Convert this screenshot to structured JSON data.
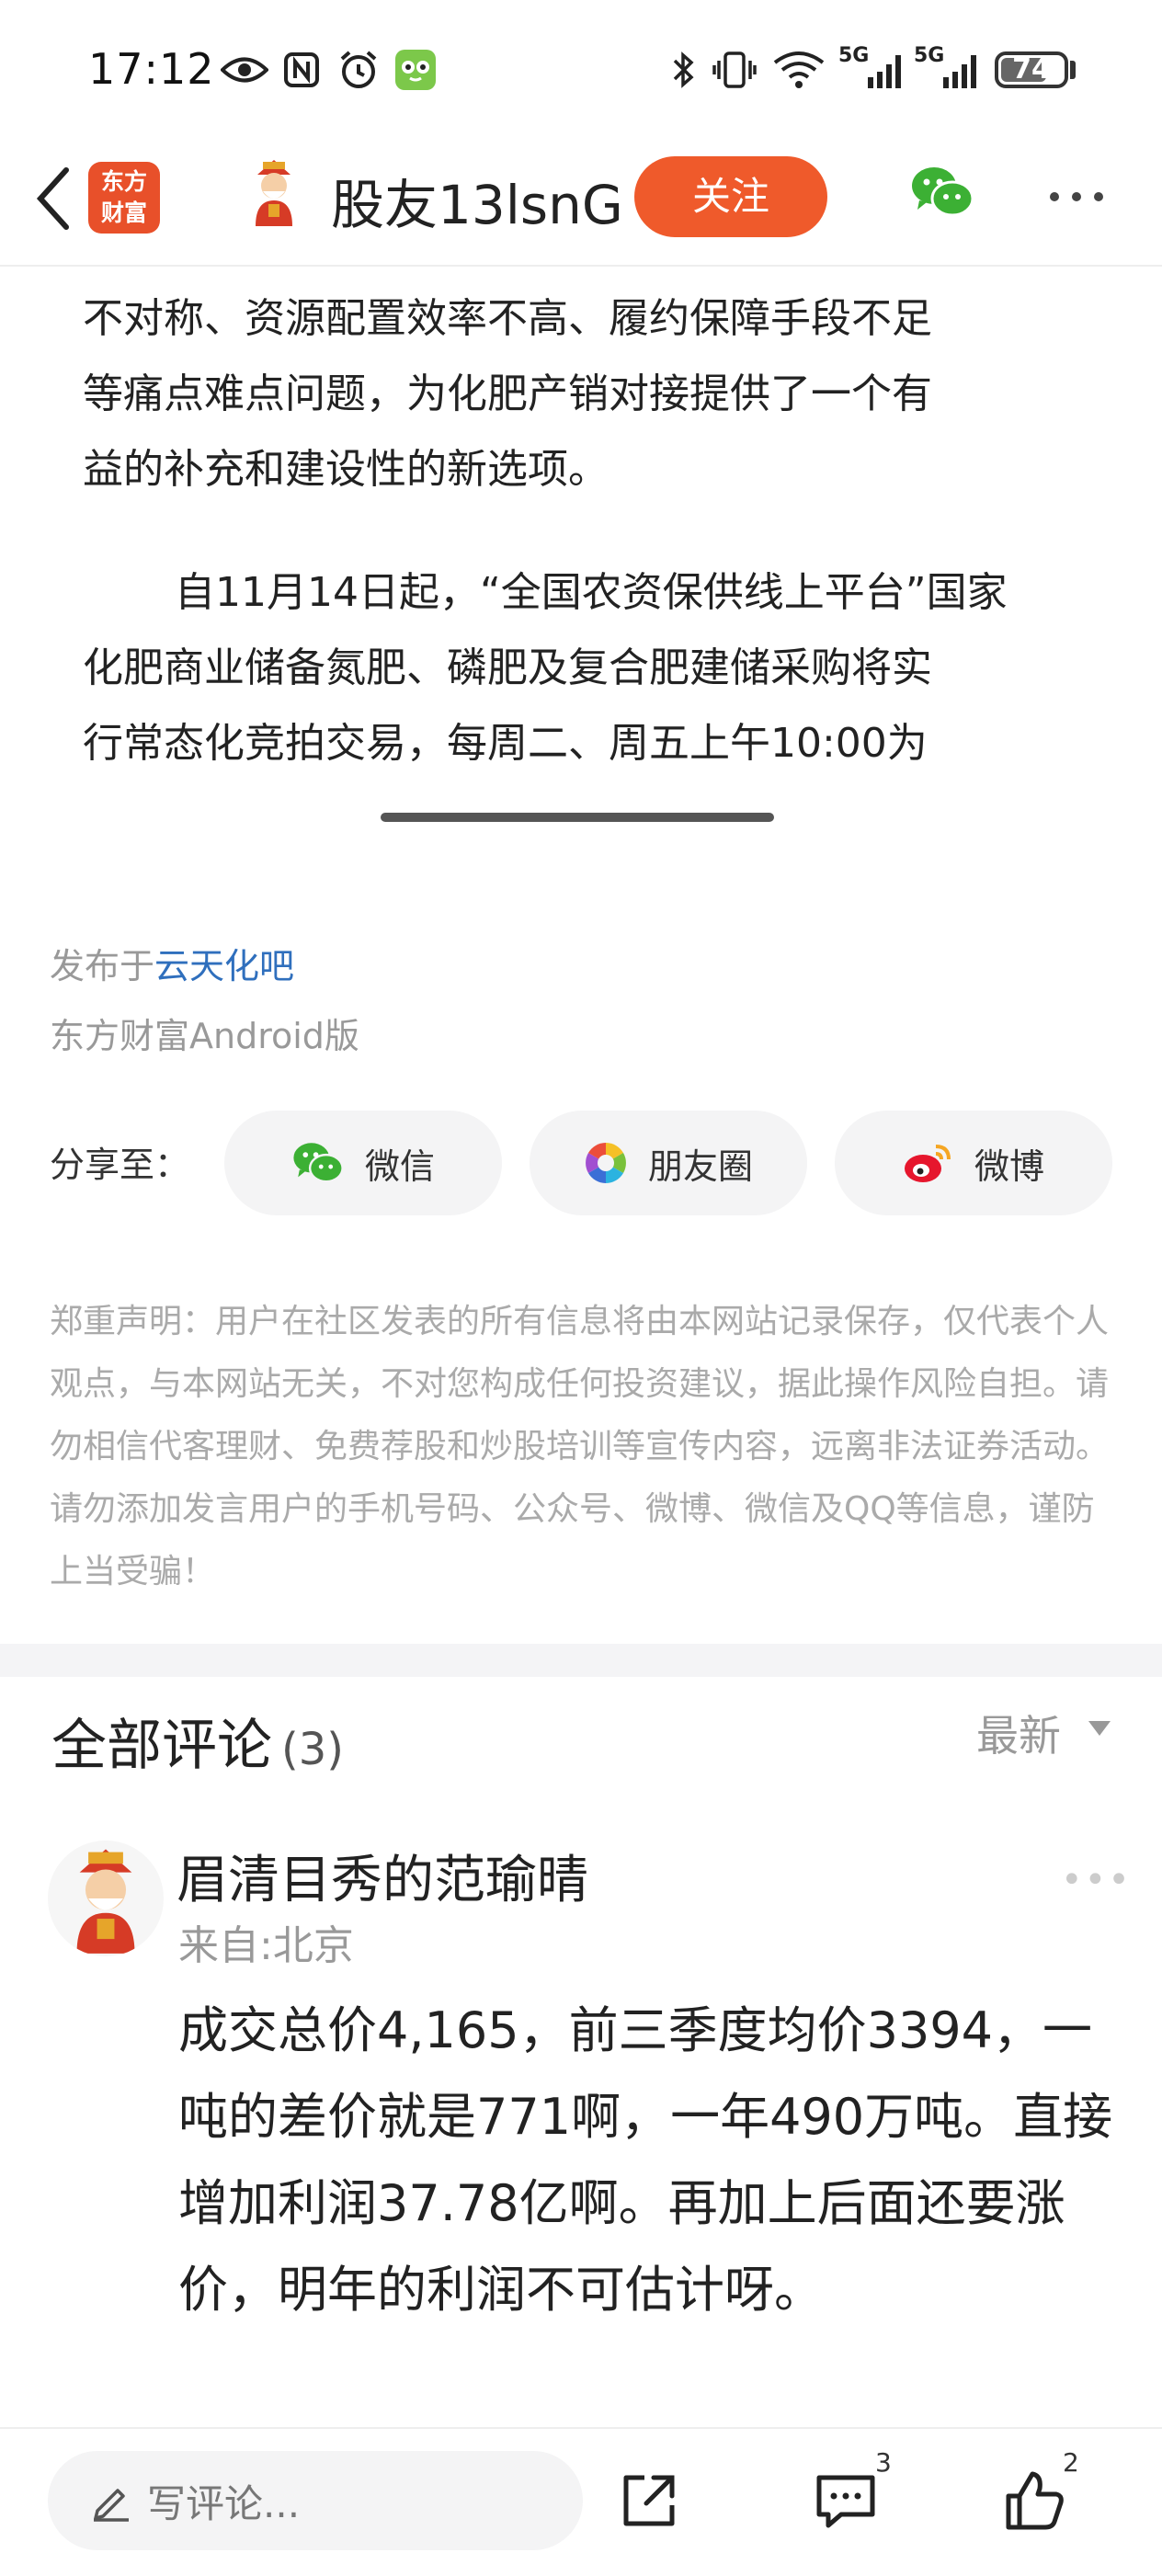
{
  "status_bar": {
    "time": "17:12",
    "network_1": "5G",
    "network_2": "5G",
    "battery": "74",
    "battery_level": 0.74
  },
  "header": {
    "logo_text": "东方\n财富",
    "username": "股友13lsnG",
    "follow_label": "关注"
  },
  "article": {
    "para1_lines": [
      "不对称、资源配置效率不高、履约保障手段不足",
      "等痛点难点问题，为化肥产销对接提供了一个有",
      "益的补充和建设性的新选项。"
    ],
    "para2_lines": [
      "自11月14日起，“全国农资保供线上平台”国家",
      "化肥商业储备氮肥、磷肥及复合肥建储采购将实",
      "行常态化竞拍交易，每周二、周五上午10:00为"
    ]
  },
  "meta": {
    "published_prefix": "发布于",
    "published_bar": "云天化吧",
    "platform": "东方财富Android版"
  },
  "share": {
    "label": "分享至：",
    "wechat": "微信",
    "moments": "朋友圈",
    "weibo": "微博"
  },
  "disclaimer": "郑重声明：用户在社区发表的所有信息将由本网站记录保存，仅代表个人观点，与本网站无关，不对您构成任何投资建议，据此操作风险自担。请勿相信代客理财、免费荐股和炒股培训等宣传内容，远离非法证券活动。请勿添加发言用户的手机号码、公众号、微博、微信及QQ等信息，谨防上当受骗！",
  "comments": {
    "title": "全部评论",
    "count": "(3)",
    "sort": "最新",
    "items": [
      {
        "user": "眉清目秀的范瑜晴",
        "location": "来自:北京",
        "more": "•••",
        "text": "成交总价4,165，前三季度均价3394，一吨的差价就是771啊，一年490万吨。直接增加利润37.78亿啊。再加上后面还要涨价，明年的利润不可估计呀。"
      }
    ]
  },
  "bottom_bar": {
    "comment_placeholder": "写评论...",
    "comment_badge": "3",
    "like_badge": "2"
  },
  "colors": {
    "accent": "#ef5a2b",
    "link": "#2f6fbd",
    "wechat_green": "#3cb034"
  },
  "icons": [
    "eye-icon",
    "nfc-icon",
    "alarm-icon",
    "app-icon",
    "bluetooth-icon",
    "vibrate-icon",
    "wifi-icon",
    "signal-icon",
    "back-icon",
    "wechat-icon",
    "more-icon",
    "moments-icon",
    "weibo-icon",
    "pencil-icon",
    "share-icon",
    "comment-icon",
    "thumbs-up-icon"
  ]
}
